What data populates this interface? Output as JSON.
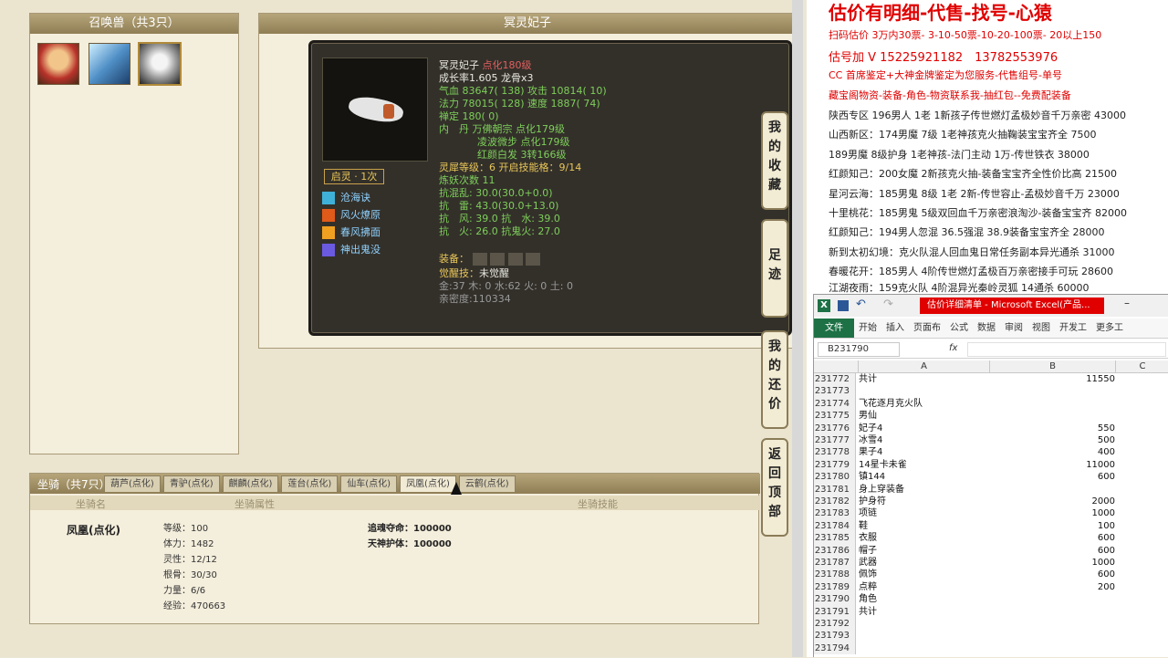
{
  "game": {
    "summon_panel_title": "召唤兽（共3只）",
    "pet_panel_title": "冥灵妃子",
    "pet": {
      "name": "冥灵妃子",
      "name_tag": "点化180级",
      "line1": "成长率1.605 龙骨x3",
      "line2": "气血 83647( 138) 攻击 10814( 10)",
      "line3": "法力 78015( 128) 速度 1887( 74)",
      "line4": "禅定 180( 0)",
      "line5": "内　丹 万佛朝宗 点化179级",
      "line6": "凌波微步 点化179级",
      "line7": "红颜白发 3转166级",
      "line8": "灵犀等级：6 开启技能格：9/14",
      "line9": "炼妖次数 11",
      "line10": "抗混乱: 30.0(30.0+0.0)",
      "line11": "抗　雷: 43.0(30.0+13.0)",
      "line12": "抗　风: 39.0 抗　水: 39.0",
      "line13": "抗　火: 26.0 抗鬼火: 27.0",
      "equip_label": "装备：",
      "awaken": "觉醒技：",
      "awaken_val": "未觉醒",
      "elements": "金:37 木: 0 水:62 火: 0 土: 0",
      "intimacy": "亲密度:110334",
      "qiling": "启灵 · 1次",
      "skills": [
        "沧海诀",
        "风火燎原",
        "春风拂面",
        "神出鬼没"
      ]
    },
    "side_buttons": [
      "我的收藏",
      "足迹",
      "我的还价",
      "返回顶部"
    ],
    "mount_title": "坐骑（共7只）",
    "mount_tabs": [
      "葫芦(点化)",
      "青驴(点化)",
      "麒麟(点化)",
      "莲台(点化)",
      "仙车(点化)",
      "凤凰(点化)",
      "云鹤(点化)"
    ],
    "mount_headers": [
      "坐骑名",
      "坐骑属性",
      "坐骑技能"
    ],
    "mount_name": "凤凰(点化)",
    "mount_attrs": [
      "等级：100",
      "体力：1482",
      "灵性：12/12",
      "根骨：30/30",
      "力量：6/6",
      "经验：470663"
    ],
    "mount_skills": [
      "追魂夺命：100000",
      "天神护体：100000"
    ]
  },
  "ad": {
    "title": "估价有明细-代售-找号-心猿",
    "lines_red": [
      "扫码估价 3万内30票- 3-10-50票-10-20-100票- 20以上150",
      "估号加 V 15225921182　13782553976",
      "CC 首席鉴定+大神金牌鉴定为您服务-代售组号-单号",
      "藏宝阁物资-装备-角色-物资联系我-抽红包--免费配装备"
    ],
    "lines": [
      "陕西专区 196男人 1老 1新孩子传世燃灯孟极妙音千万亲密 43000",
      "山西新区：174男魔 7级 1老神孩克火抽鞠装宝宝齐全 7500",
      "189男魔 8级护身 1老神孩-法门主动 1万-传世铁衣 38000",
      "红颜知己：200女魔 2新孩克火抽-装备宝宝齐全性价比高 21500",
      "星河云海：185男鬼 8级 1老 2新-传世容止-孟极妙音千万 23000",
      "十里桃花：185男鬼 5级双回血千万亲密浪淘沙-装备宝宝齐 82000",
      "红颜知己：194男人忽混 36.5强混 38.9装备宝宝齐全 28000",
      "新到太初幻境：克火队混人回血鬼日常任务副本异光通杀 31000",
      "春暖花开：185男人 4阶传世燃灯孟极百万亲密接手可玩 28600",
      "江湖夜雨：159克火队 4阶混异光秦岭灵狐 14通杀 60000"
    ]
  },
  "excel": {
    "title": "估价详细清单 - Microsoft Excel(产品...",
    "ribbon_tabs": [
      "文件",
      "开始",
      "插入",
      "页面布",
      "公式",
      "数据",
      "审阅",
      "视图",
      "开发工",
      "更多工"
    ],
    "name_box": "B231790",
    "fx": "fx",
    "col_headers": [
      "A",
      "B",
      "C"
    ],
    "rows": [
      {
        "n": "231772",
        "a": "共计",
        "b": "11550"
      },
      {
        "n": "231773",
        "a": "",
        "b": ""
      },
      {
        "n": "231774",
        "a": "飞花逐月克火队",
        "b": ""
      },
      {
        "n": "231775",
        "a": "男仙",
        "b": ""
      },
      {
        "n": "231776",
        "a": "妃子4",
        "b": "550"
      },
      {
        "n": "231777",
        "a": "冰雪4",
        "b": "500"
      },
      {
        "n": "231778",
        "a": "果子4",
        "b": "400"
      },
      {
        "n": "231779",
        "a": "14星卡未雀",
        "b": "11000"
      },
      {
        "n": "231780",
        "a": "镇144",
        "b": "600"
      },
      {
        "n": "231781",
        "a": "身上穿装备",
        "b": ""
      },
      {
        "n": "231782",
        "a": "护身符",
        "b": "2000"
      },
      {
        "n": "231783",
        "a": "项链",
        "b": "1000"
      },
      {
        "n": "231784",
        "a": "鞋",
        "b": "100"
      },
      {
        "n": "231785",
        "a": "衣服",
        "b": "600"
      },
      {
        "n": "231786",
        "a": "帽子",
        "b": "600"
      },
      {
        "n": "231787",
        "a": "武器",
        "b": "1000"
      },
      {
        "n": "231788",
        "a": "佩饰",
        "b": "600"
      },
      {
        "n": "231789",
        "a": "点粹",
        "b": "200"
      },
      {
        "n": "231790",
        "a": "角色",
        "b": ""
      },
      {
        "n": "231791",
        "a": "共计",
        "b": ""
      },
      {
        "n": "231792",
        "a": "",
        "b": ""
      },
      {
        "n": "231793",
        "a": "",
        "b": ""
      },
      {
        "n": "231794",
        "a": "",
        "b": ""
      }
    ]
  }
}
